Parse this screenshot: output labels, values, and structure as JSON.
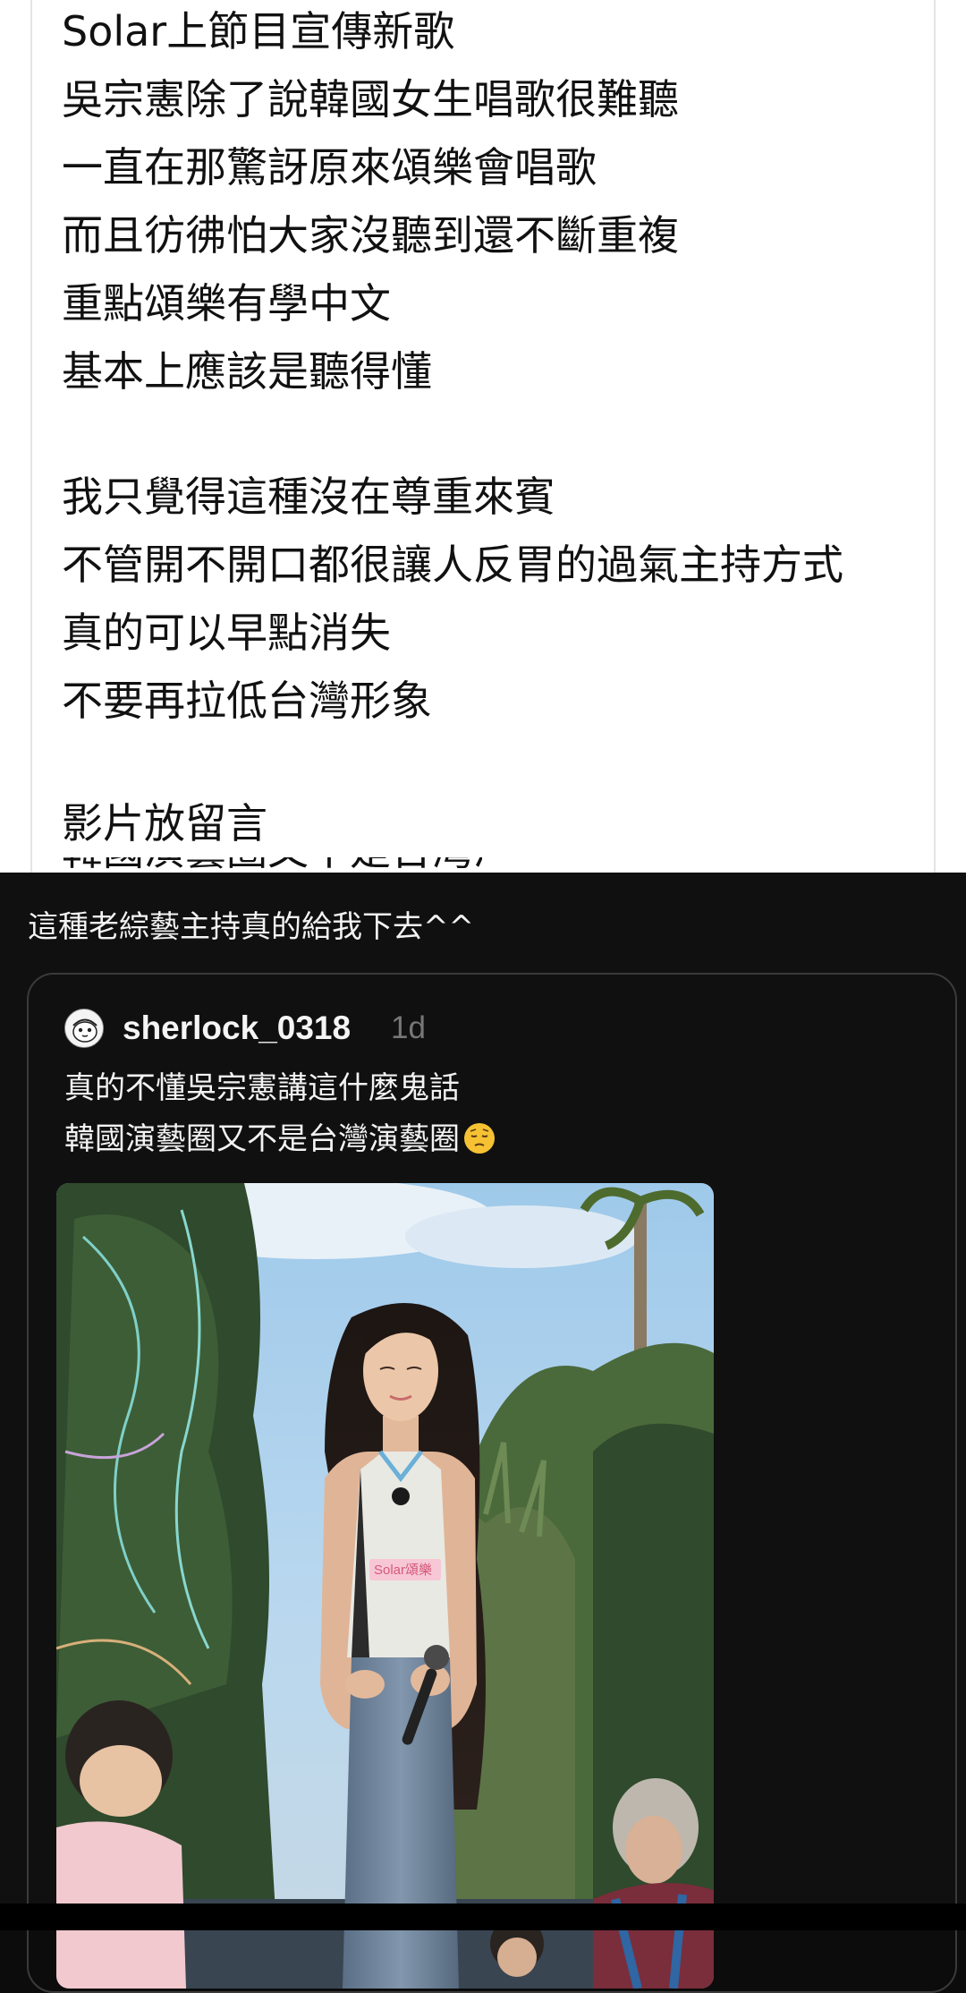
{
  "post": {
    "lines": [
      "Solar上節目宣傳新歌",
      "吳宗憲除了說韓國女生唱歌很難聽",
      "一直在那驚訝原來頌樂會唱歌",
      "而且彷彿怕大家沒聽到還不斷重複",
      "重點頌樂有學中文",
      "基本上應該是聽得懂",
      "我只覺得這種沒在尊重來賓",
      "不管開不開口都很讓人反胃的過氣主持方式",
      "真的可以早點消失",
      "不要再拉低台灣形象",
      "影片放留言"
    ],
    "cut_line": "韓國演藝圈又不是台灣演藝圈"
  },
  "reply": {
    "text": "這種老綜藝主持真的給我下去^^"
  },
  "quoted_post": {
    "username": "sherlock_0318",
    "time": "1d",
    "lines": [
      "真的不懂吳宗憲講這什麼鬼話",
      "韓國演藝圈又不是台灣演藝圈"
    ],
    "emoji": "pensive-face-emoji",
    "video_badge": "Solar頌樂"
  },
  "colors": {
    "light_bg": "#ffffff",
    "dark_bg": "#101010",
    "username": "#f5f5f5",
    "timestamp": "#777777",
    "card_border": "#3a3a3a"
  }
}
